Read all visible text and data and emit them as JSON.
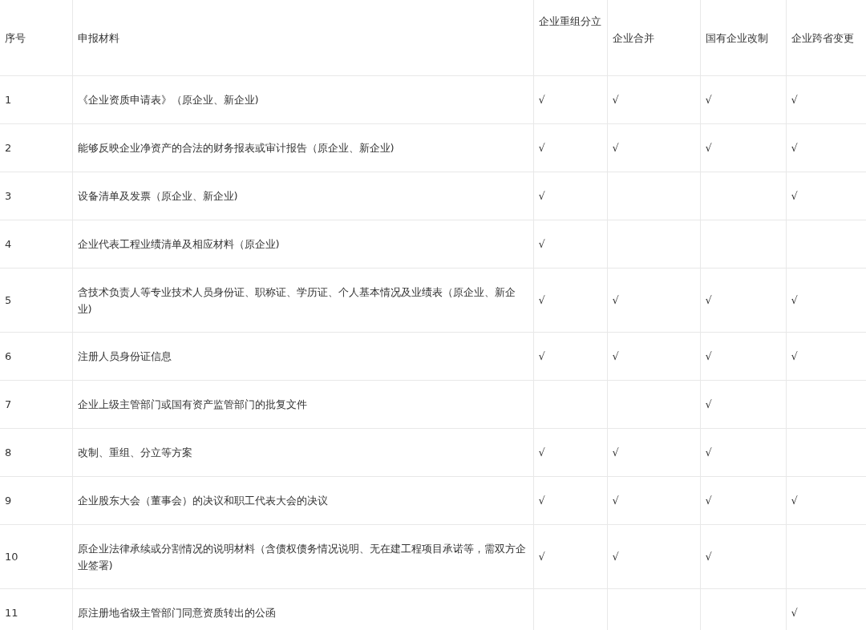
{
  "table": {
    "columns": [
      "序号",
      "申报材料",
      "企业重组分立",
      "企业合并",
      "国有企业改制",
      "企业跨省变更"
    ],
    "rows": [
      {
        "no": "1",
        "material": "《企业资质申请表》（原企业、新企业)",
        "split": "√",
        "merger": "√",
        "reform": "√",
        "transfer": "√"
      },
      {
        "no": "2",
        "material": "能够反映企业净资产的合法的财务报表或审计报告（原企业、新企业)",
        "split": "√",
        "merger": "√",
        "reform": "√",
        "transfer": "√"
      },
      {
        "no": "3",
        "material": "设备清单及发票（原企业、新企业)",
        "split": "√",
        "transfer": "√"
      },
      {
        "no": "4",
        "material": "企业代表工程业绩清单及相应材料（原企业)",
        "split": "√"
      },
      {
        "no": "5",
        "material": "含技术负责人等专业技术人员身份证、职称证、学历证、个人基本情况及业绩表（原企业、新企业)",
        "split": "√",
        "merger": "√",
        "reform": "√",
        "transfer": "√"
      },
      {
        "no": "6",
        "material": "注册人员身份证信息",
        "split": "√",
        "merger": "√",
        "reform": "√",
        "transfer": "√"
      },
      {
        "no": "7",
        "material": "企业上级主管部门或国有资产监管部门的批复文件",
        "reform": "√"
      },
      {
        "no": "8",
        "material": "改制、重组、分立等方案",
        "split": "√",
        "merger": "√",
        "reform": "√"
      },
      {
        "no": "9",
        "material": "企业股东大会（董事会）的决议和职工代表大会的决议",
        "split": "√",
        "merger": "√",
        "reform": "√",
        "transfer": "√"
      },
      {
        "no": "10",
        "material": "原企业法律承续或分割情况的说明材料（含债权债务情况说明、无在建工程项目承诺等，需双方企业签署)",
        "split": "√",
        "merger": "√",
        "reform": "√"
      },
      {
        "no": "11",
        "material": "原注册地省级主管部门同意资质转出的公函",
        "transfer": "√"
      }
    ]
  }
}
